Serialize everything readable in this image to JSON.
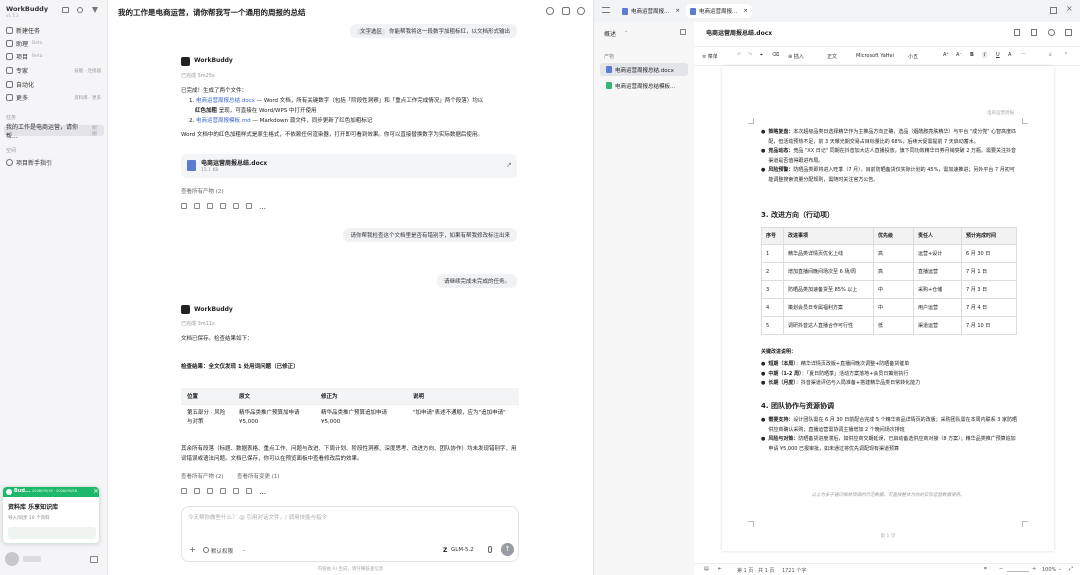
{
  "sidebar": {
    "app_name": "WorkBuddy",
    "version": "v1.1.3",
    "items": [
      {
        "label": "新建任务",
        "tag": ""
      },
      {
        "label": "助理",
        "tag": "Beta"
      },
      {
        "label": "项目",
        "tag": "Beta"
      },
      {
        "label": "专家",
        "tag": "",
        "right": "技能 · 连接器"
      },
      {
        "label": "自动化",
        "tag": ""
      },
      {
        "label": "更多",
        "tag": "",
        "right": "资料库 · 更多"
      }
    ],
    "section_tasks": "任务",
    "active_task": "我的工作是电商运营，请你帮...",
    "active_task_right": "刚刚",
    "section_space": "空间",
    "space_item": "项目新手指引"
  },
  "toast": {
    "header": "Bud...",
    "header_tag": "2026/05/19 · 2026/05/26",
    "title": "资料库 乐享知识库",
    "body": "导入/同步 10 个资料"
  },
  "chat": {
    "title": "我的工作是电商运营，请你帮我写一个通用的周报的总结",
    "user_msg_1_tag": "文字选区",
    "user_msg_1": "你能帮我将这一段数字加粗标红，以文档形式输出",
    "assistant_name": "WorkBuddy",
    "meta_1": "已完成 5m25s",
    "reply_1_intro": "已完成！生成了两个文件：",
    "reply_1_file1": "电商运营周报总结.docx",
    "reply_1_file1_desc": " — Word 文档，所有关键数字（包括「阶段性洞察」和「重点工作完成情况」两个段落）均以",
    "reply_1_file1_desc2_bold": "红色加粗",
    "reply_1_file1_desc2": " 呈现，可直接在 Word/WPS 中打开使用",
    "reply_1_file2": "电商运营周报模板.md",
    "reply_1_file2_desc": " — Markdown 源文件，同步更新了红色加粗标记",
    "reply_1_outro": "Word 文档中的红色加粗样式是原生格式，不依赖任何渲染器，打开即可看到效果。你可以直接替换数字为实际数据后使用。",
    "file_card_name": "电商运营周报总结.docx",
    "file_card_size": "15.1 KB",
    "view_all_1": "查看所有产物 (2)",
    "user_msg_2": "请你帮我检查这个文档里是否有错别字，如果有帮我修改标注出来",
    "user_msg_3": "请继续完成未完成的任务。",
    "meta_2": "已完成 3m11s",
    "reply_2_intro": "文档已保存。检查结果如下：",
    "reply_2_result": "检查结果：全文仅发现 1 处用词问题（已修正）",
    "table_headers": [
      "位置",
      "原文",
      "修正为",
      "说明"
    ],
    "table_rows": [
      [
        "第五部分 · 风险与对策",
        "精华品类推广预算加申请¥5,000",
        "精华品类推广预算追加申请¥5,000",
        "\"加申请\"表述不通顺，应为\"追加申请\""
      ]
    ],
    "reply_2_outro": "其余所有段落（标题、数据表格、重点工作、问题与改进、下周计划、阶段性洞察、深度思考、改进方向、团队协作）均未发现错别字、用词错误或语法问题。文档已保存，你可以在预览面板中查看修改后的效果。",
    "view_all_2": "查看所有产物 (2)",
    "view_changes": "查看所有变更 (1)",
    "input_placeholder": "今天帮你做些什么？  @ 引用对话文件，/ 调用技能与指令",
    "permission": "默认权限",
    "model": "GLM-5.2",
    "footer_note": "内容由 AI 生成，请仔细核查信息"
  },
  "viewer": {
    "tabs": [
      "电商运营周报...",
      "电商运营周报..."
    ],
    "outline_title": "概述",
    "outline_section": "产物",
    "outline_files": [
      "电商运营周报总结.docx",
      "电商运营周报总结模板..."
    ],
    "doc_title": "电商运营周报总结.docx",
    "toolbar": {
      "menu": "菜单",
      "insert": "插入",
      "style": "正文",
      "font": "Microsoft YaHei",
      "size": "小五"
    },
    "page_header": "电商运营周报",
    "bullets_top": [
      {
        "bold": "策略复盘：",
        "text": "本次超级品类日选择精华作为主推品方向正确，选品（烟酰胺亮肤精华）与平台 \"成分党\" 心智高度匹配，但活动预热不足，前 3 天曝光期交易占目标量比的 68%，后续大促需提前 7 天启动蓄水。"
      },
      {
        "bold": "竞品动态：",
        "text": "竞品 \"XX 日记\" 同期在抖音加大达人直播投放，旗下同功效精华日券月销突破 2 万瓶。需要关注抖音渠道是否值得跟进布局。"
      },
      {
        "bold": "风险预警：",
        "text": "防晒品类即将进入旺季（7 月），目前防晒备货仅实际计划的 45%，需加速推进；另外平台 7 月初可能调整搜索流量分配规则，需随时关注官方公告。"
      }
    ],
    "section3_title": "3. 改进方向（行动项）",
    "table_headers": [
      "序号",
      "改进事项",
      "优先级",
      "责任人",
      "预计完成时间"
    ],
    "table_rows": [
      [
        "1",
        "精华品类详情页优化上线",
        "高",
        "运营+设计",
        "6 月 30 日"
      ],
      [
        "2",
        "增加直播间晚间场次至 6 场/周",
        "高",
        "直播运营",
        "7 月 1 日"
      ],
      [
        "3",
        "防晒品类加速备货至 85% 以上",
        "中",
        "采购+仓储",
        "7 月 3 日"
      ],
      [
        "4",
        "策划会员日专属福利方案",
        "中",
        "用户运营",
        "7 月 4 日"
      ],
      [
        "5",
        "调研抖音达人直播合作可行性",
        "低",
        "渠道运营",
        "7 月 10 日"
      ]
    ],
    "rhythm_title": "关键改进说明：",
    "rhythm": [
      {
        "bold": "短期（本周）",
        "text": "：精华详情页改版+直播间晚次调整+防晒备货催单"
      },
      {
        "bold": "中期（1-2 周）",
        "text": "：「夏日防晒季」活动方案落地+会员日策划执行"
      },
      {
        "bold": "长期（月度）",
        "text": "：抖音渠道评估与入局准备+搭建精华品类日常转化能力"
      }
    ],
    "section4_title": "4. 团队协作与资源协调",
    "bullets_bottom": [
      {
        "bold": "需要支持：",
        "text": "设计团队需在 6 月 30 日前配合完成 5 个精华商品详情页的改版；采购团队需在本周内联系 3 家防晒供应商确认采购；直播运营需协调主播增加 2 个晚间场次排班"
      },
      {
        "bold": "风险与对策：",
        "text": "防晒备货进度滞后，如供应商交期延误，已启动备选供应商对接（8 方案）；精华品类推广预算追加申请 ¥5,000 已报审批，如未通过将优先调配现有渠道预算"
      }
    ],
    "page_footnote": "以上为多于通识细单项调的示范数据，可直接整体为你的实际运营数据使用。",
    "page_number": "第 1 页",
    "status_page": "第 1 页 · 共 1 页",
    "status_words": "1721 个字",
    "zoom": "100%"
  }
}
